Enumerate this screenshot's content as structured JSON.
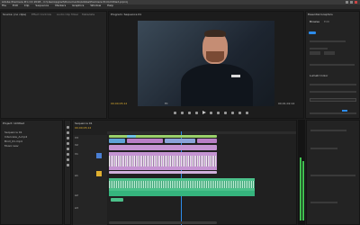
{
  "titlebar": {
    "title": "Adobe Premiere Pro CC 2018 - C:\\Users\\pgrad\\Documents\\Adobe\\Premiere Pro\\Untitled.prproj"
  },
  "menubar": {
    "items": [
      "File",
      "Edit",
      "Clip",
      "Sequence",
      "Markers",
      "Graphics",
      "Window",
      "Help"
    ]
  },
  "source_panel": {
    "tabs": [
      "Source: (no clips)",
      "Effect Controls",
      "Audio Clip Mixer",
      "Metadata"
    ]
  },
  "program_panel": {
    "title": "Program: Sequence 01",
    "timecode_left": "00;00;05;12",
    "timecode_right": "00;01;02;14",
    "fit": "Fit"
  },
  "right_panel": {
    "title": "Essential Graphics",
    "tabs": [
      "Browse",
      "Edit"
    ],
    "section": "Lumetri Color"
  },
  "project_panel": {
    "title": "Project: Untitled",
    "items": [
      "Sequence 01",
      "Interview_A.mp4",
      "Broll_01.mp4",
      "Music.wav"
    ]
  },
  "timeline": {
    "title": "Sequence 01",
    "timecode": "00;00;05;12",
    "tracks": [
      "V3",
      "V2",
      "V1",
      "A1",
      "A2",
      "A3"
    ]
  },
  "colors": {
    "accent": "#2d8ceb",
    "video_clip": "#b87ec5",
    "audio_clip": "#4bc08a",
    "adjust_clip": "#8aa3d9",
    "playhead": "#2d8ceb"
  },
  "icons": [
    "close-icon",
    "minimize-icon",
    "play-icon",
    "step-back-icon",
    "step-forward-icon",
    "wrench-icon",
    "razor-tool-icon",
    "selection-tool-icon"
  ]
}
